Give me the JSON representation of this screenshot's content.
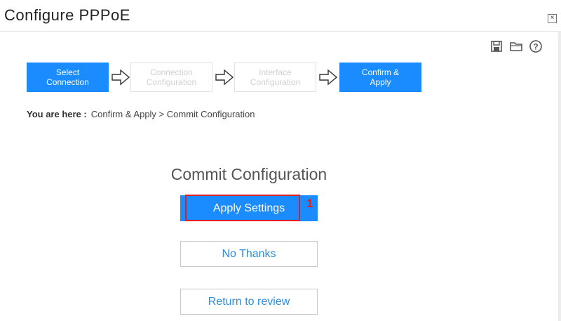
{
  "window": {
    "title": "Configure PPPoE",
    "close_glyph": "×"
  },
  "toolbar": {
    "icons": [
      "save-icon",
      "folder-icon",
      "help-icon"
    ]
  },
  "wizard": {
    "steps": [
      {
        "line1": "Select",
        "line2": "Connection",
        "state": "active"
      },
      {
        "line1": "Connection",
        "line2": "Configuration",
        "state": "inactive"
      },
      {
        "line1": "Interface",
        "line2": "Configuration",
        "state": "inactive"
      },
      {
        "line1": "Confirm &",
        "line2": "Apply",
        "state": "active"
      }
    ]
  },
  "breadcrumb": {
    "label": "You are here :",
    "path": "Confirm & Apply > Commit Configuration"
  },
  "main": {
    "heading": "Commit Configuration",
    "apply_label": "Apply Settings",
    "no_thanks_label": "No Thanks",
    "review_label": "Return to review"
  },
  "annotation": {
    "number": "1"
  },
  "colors": {
    "accent": "#1a8cff",
    "highlight": "#e02020",
    "link": "#2a8fe0"
  }
}
